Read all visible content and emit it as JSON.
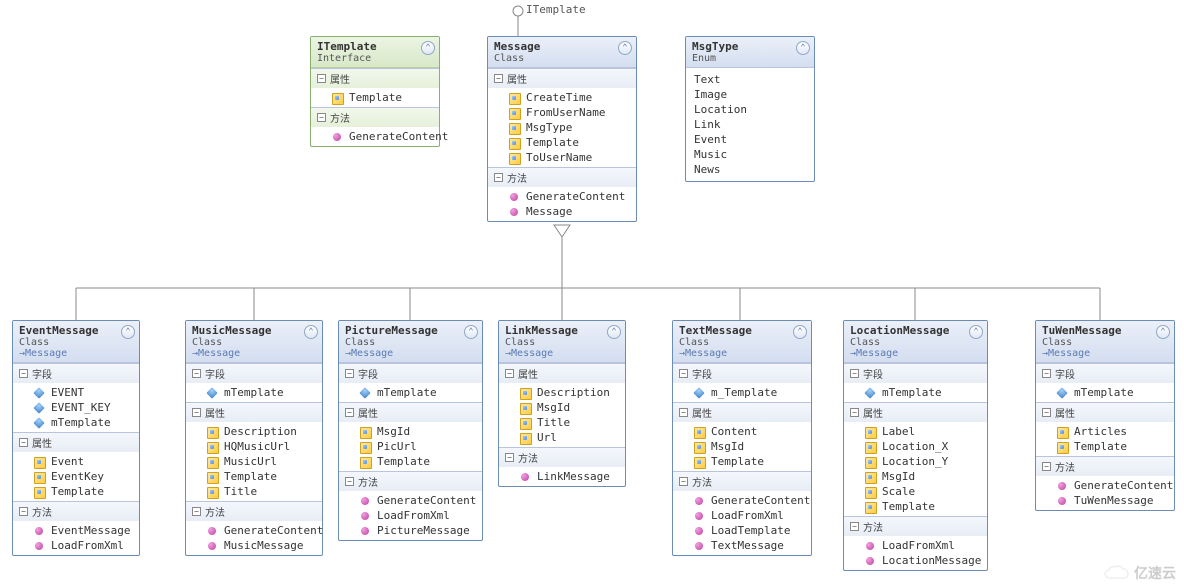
{
  "interface_label": "ITemplate",
  "watermark": "亿速云",
  "sections": {
    "fields": "字段",
    "props": "属性",
    "methods": "方法"
  },
  "classes": {
    "itemplate": {
      "name": "ITemplate",
      "stereo": "Interface",
      "props": [
        "Template"
      ],
      "methods": [
        "GenerateContent"
      ]
    },
    "message": {
      "name": "Message",
      "stereo": "Class",
      "props": [
        "CreateTime",
        "FromUserName",
        "MsgType",
        "Template",
        "ToUserName"
      ],
      "methods": [
        "GenerateContent",
        "Message"
      ]
    },
    "msgtype": {
      "name": "MsgType",
      "stereo": "Enum",
      "items": [
        "Text",
        "Image",
        "Location",
        "Link",
        "Event",
        "Music",
        "News"
      ]
    },
    "event": {
      "name": "EventMessage",
      "stereo": "Class",
      "inherit": "Message",
      "fields": [
        "EVENT",
        "EVENT_KEY",
        "mTemplate"
      ],
      "props": [
        "Event",
        "EventKey",
        "Template"
      ],
      "methods": [
        "EventMessage",
        "LoadFromXml"
      ]
    },
    "music": {
      "name": "MusicMessage",
      "stereo": "Class",
      "inherit": "Message",
      "fields": [
        "mTemplate"
      ],
      "props": [
        "Description",
        "HQMusicUrl",
        "MusicUrl",
        "Template",
        "Title"
      ],
      "methods": [
        "GenerateContent",
        "MusicMessage"
      ]
    },
    "picture": {
      "name": "PictureMessage",
      "stereo": "Class",
      "inherit": "Message",
      "fields": [
        "mTemplate"
      ],
      "props": [
        "MsgId",
        "PicUrl",
        "Template"
      ],
      "methods": [
        "GenerateContent",
        "LoadFromXml",
        "PictureMessage"
      ]
    },
    "link": {
      "name": "LinkMessage",
      "stereo": "Class",
      "inherit": "Message",
      "props": [
        "Description",
        "MsgId",
        "Title",
        "Url"
      ],
      "methods": [
        "LinkMessage"
      ]
    },
    "text": {
      "name": "TextMessage",
      "stereo": "Class",
      "inherit": "Message",
      "fields": [
        "m_Template"
      ],
      "props": [
        "Content",
        "MsgId",
        "Template"
      ],
      "methods": [
        "GenerateContent",
        "LoadFromXml",
        "LoadTemplate",
        "TextMessage"
      ]
    },
    "location": {
      "name": "LocationMessage",
      "stereo": "Class",
      "inherit": "Message",
      "fields": [
        "mTemplate"
      ],
      "props": [
        "Label",
        "Location_X",
        "Location_Y",
        "MsgId",
        "Scale",
        "Template"
      ],
      "methods": [
        "LoadFromXml",
        "LocationMessage"
      ]
    },
    "tuwen": {
      "name": "TuWenMessage",
      "stereo": "Class",
      "inherit": "Message",
      "fields": [
        "mTemplate"
      ],
      "props": [
        "Articles",
        "Template"
      ],
      "methods": [
        "GenerateContent",
        "TuWenMessage"
      ]
    }
  },
  "chart_data": {
    "type": "table",
    "title": "UML Class Diagram - Message Hierarchy",
    "relationships": [
      {
        "from": "ITemplate",
        "to": "Message",
        "kind": "lollipop-interface"
      },
      {
        "from": "Message",
        "to": "EventMessage",
        "kind": "inheritance"
      },
      {
        "from": "Message",
        "to": "MusicMessage",
        "kind": "inheritance"
      },
      {
        "from": "Message",
        "to": "PictureMessage",
        "kind": "inheritance"
      },
      {
        "from": "Message",
        "to": "LinkMessage",
        "kind": "inheritance"
      },
      {
        "from": "Message",
        "to": "TextMessage",
        "kind": "inheritance"
      },
      {
        "from": "Message",
        "to": "LocationMessage",
        "kind": "inheritance"
      },
      {
        "from": "Message",
        "to": "TuWenMessage",
        "kind": "inheritance"
      }
    ]
  }
}
